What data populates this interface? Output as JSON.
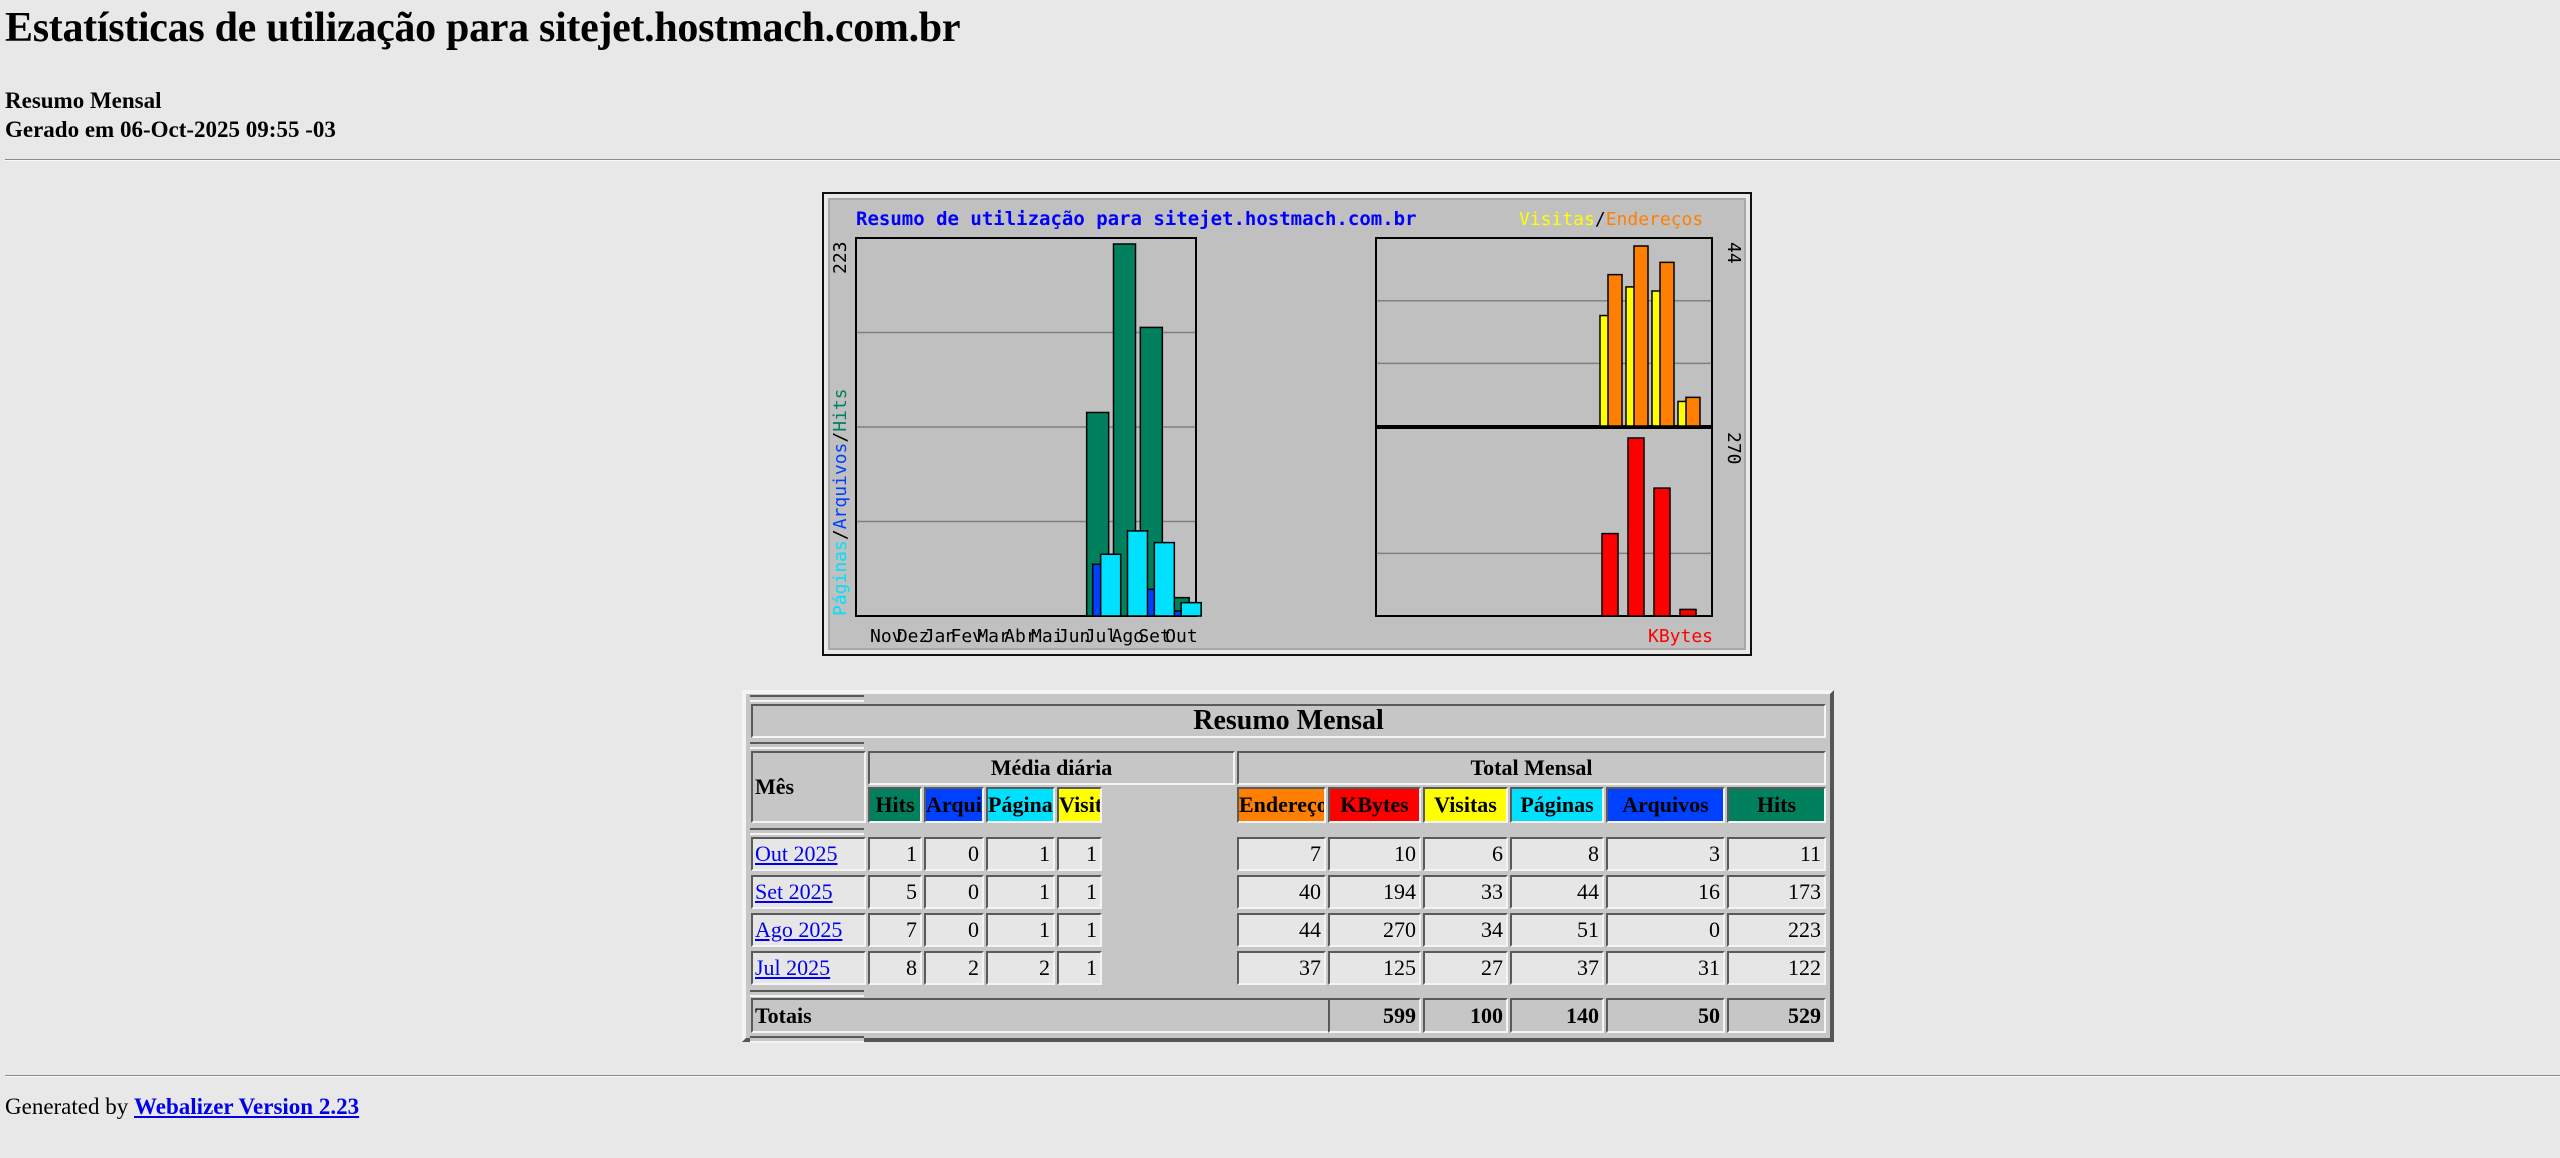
{
  "page": {
    "title": "Estatísticas de utilização para sitejet.hostmach.com.br",
    "subtitle": "Resumo Mensal",
    "generated": "Gerado em 06-Oct-2025 09:55 -03",
    "footer_prefix": "Generated by",
    "footer_link": "Webalizer Version 2.23"
  },
  "colors": {
    "hits": "#00805c",
    "files": "#0040ff",
    "pages": "#00e0ff",
    "visits": "#ffff00",
    "sites": "#ff8000",
    "kbytes": "#ff0000",
    "graph_bg": "#c0c0c0",
    "title_blue": "#0000ff"
  },
  "chart_data": {
    "type": "bar",
    "title": "Resumo de utilização para sitejet.hostmach.com.br",
    "categories": [
      "Nov",
      "Dez",
      "Jan",
      "Fev",
      "Mar",
      "Abr",
      "Mai",
      "Jun",
      "Jul",
      "Ago",
      "Set",
      "Out"
    ],
    "left_axis": {
      "label_parts": [
        "Páginas",
        "/",
        "Arquivos",
        "/",
        "Hits"
      ],
      "max_label": "223",
      "ylim": [
        0,
        223
      ],
      "series": [
        {
          "name": "Hits",
          "color": "#00805c",
          "values": [
            0,
            0,
            0,
            0,
            0,
            0,
            0,
            0,
            122,
            223,
            173,
            11
          ]
        },
        {
          "name": "Arquivos",
          "color": "#0040ff",
          "values": [
            0,
            0,
            0,
            0,
            0,
            0,
            0,
            0,
            31,
            0,
            16,
            3
          ]
        },
        {
          "name": "Páginas",
          "color": "#00e0ff",
          "values": [
            0,
            0,
            0,
            0,
            0,
            0,
            0,
            0,
            37,
            51,
            44,
            8
          ]
        }
      ]
    },
    "right_top": {
      "legend_parts": [
        "Visitas",
        "/",
        "Endereços"
      ],
      "max_label": "44",
      "ylim": [
        0,
        44
      ],
      "series": [
        {
          "name": "Visitas",
          "color": "#ffff00",
          "values": [
            27,
            34,
            33,
            6
          ]
        },
        {
          "name": "Endereços",
          "color": "#ff8000",
          "values": [
            37,
            44,
            40,
            7
          ]
        }
      ]
    },
    "right_bottom": {
      "legend": "KBytes",
      "max_label": "270",
      "ylim": [
        0,
        270
      ],
      "series": [
        {
          "name": "KBytes",
          "color": "#ff0000",
          "values": [
            125,
            270,
            194,
            10
          ]
        }
      ]
    },
    "grid": true
  },
  "table": {
    "title": "Resumo Mensal",
    "month_header": "Mês",
    "daily_header": "Média diária",
    "total_header": "Total Mensal",
    "daily_cols": [
      {
        "label": "Hits",
        "color": "#00805c"
      },
      {
        "label": "Arquivos",
        "color": "#0040ff"
      },
      {
        "label": "Páginas",
        "color": "#00e0ff"
      },
      {
        "label": "Visitas",
        "color": "#ffff00"
      }
    ],
    "total_cols": [
      {
        "label": "Endereços",
        "color": "#ff8000"
      },
      {
        "label": "KBytes",
        "color": "#ff0000"
      },
      {
        "label": "Visitas",
        "color": "#ffff00"
      },
      {
        "label": "Páginas",
        "color": "#00e0ff"
      },
      {
        "label": "Arquivos",
        "color": "#0040ff"
      },
      {
        "label": "Hits",
        "color": "#00805c"
      }
    ],
    "rows": [
      {
        "month": "Out 2025",
        "values": [
          "1",
          "0",
          "1",
          "1",
          "7",
          "10",
          "6",
          "8",
          "3",
          "11"
        ]
      },
      {
        "month": "Set 2025",
        "values": [
          "5",
          "0",
          "1",
          "1",
          "40",
          "194",
          "33",
          "44",
          "16",
          "173"
        ]
      },
      {
        "month": "Ago 2025",
        "values": [
          "7",
          "0",
          "1",
          "1",
          "44",
          "270",
          "34",
          "51",
          "0",
          "223"
        ]
      },
      {
        "month": "Jul 2025",
        "values": [
          "8",
          "2",
          "2",
          "1",
          "37",
          "125",
          "27",
          "37",
          "31",
          "122"
        ]
      }
    ],
    "totals_label": "Totais",
    "totals": [
      "599",
      "100",
      "140",
      "50",
      "529"
    ]
  }
}
